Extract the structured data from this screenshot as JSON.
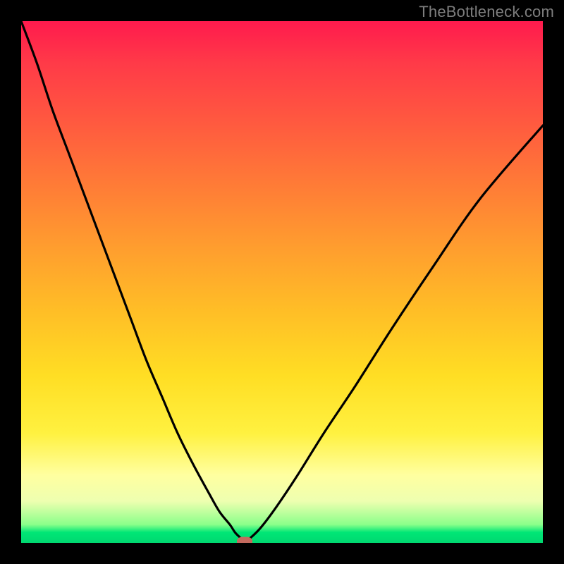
{
  "watermark": "TheBottleneck.com",
  "chart_data": {
    "type": "line",
    "title": "",
    "xlabel": "",
    "ylabel": "",
    "xlim": [
      0,
      100
    ],
    "ylim": [
      0,
      100
    ],
    "series": [
      {
        "name": "bottleneck-curve",
        "x": [
          0,
          3,
          6,
          9,
          12,
          15,
          18,
          21,
          24,
          27,
          30,
          33,
          36,
          38,
          40,
          41,
          42,
          42.8,
          44,
          46,
          49,
          53,
          58,
          64,
          71,
          79,
          88,
          100
        ],
        "y": [
          100,
          92,
          83,
          75,
          67,
          59,
          51,
          43,
          35,
          28,
          21,
          15,
          9.5,
          6,
          3.5,
          2,
          1,
          0.3,
          1,
          3,
          7,
          13,
          21,
          30,
          41,
          53,
          66,
          80
        ]
      }
    ],
    "marker": {
      "x": 42.8,
      "y": 0.3,
      "color": "#c46a5e"
    },
    "background_gradient": {
      "stops": [
        {
          "pos": 0.0,
          "color": "#ff1a4d"
        },
        {
          "pos": 0.2,
          "color": "#ff5b3f"
        },
        {
          "pos": 0.44,
          "color": "#ff9f2e"
        },
        {
          "pos": 0.68,
          "color": "#ffde24"
        },
        {
          "pos": 0.87,
          "color": "#ffffa0"
        },
        {
          "pos": 0.97,
          "color": "#2aff7a"
        },
        {
          "pos": 1.0,
          "color": "#00d870"
        }
      ]
    }
  }
}
